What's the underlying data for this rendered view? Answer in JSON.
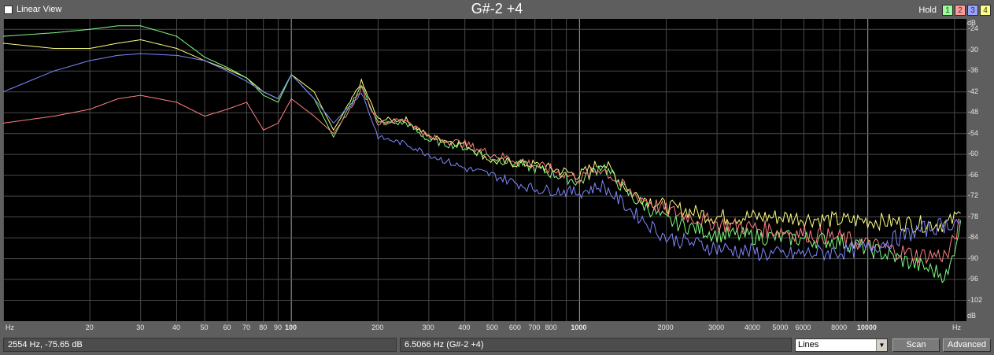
{
  "header": {
    "linear_view_label": "Linear View",
    "title": "G#-2 +4",
    "hold_label": "Hold",
    "hold_buttons": [
      {
        "label": "1",
        "color": "#9aff9a"
      },
      {
        "label": "2",
        "color": "#ff9a9a"
      },
      {
        "label": "3",
        "color": "#9aa2ff"
      },
      {
        "label": "4",
        "color": "#ffff88"
      }
    ]
  },
  "status": {
    "cursor_readout": "2554 Hz, -75.65 dB",
    "pitch_readout": "6.5066 Hz (G#-2 +4)",
    "mode_select": "Lines",
    "scan_label": "Scan",
    "advanced_label": "Advanced"
  },
  "chart_data": {
    "type": "line",
    "x_scale": "log",
    "xlim": [
      10,
      22000
    ],
    "ylim": [
      -108,
      -21
    ],
    "x_unit_label": "Hz",
    "y_unit_label": "dB",
    "y_ticks": [
      -24,
      -30,
      -36,
      -42,
      -48,
      -54,
      -60,
      -66,
      -72,
      -78,
      -84,
      -90,
      -96,
      -102
    ],
    "x_ticks": [
      {
        "v": 20,
        "label": "20"
      },
      {
        "v": 30,
        "label": "30"
      },
      {
        "v": 40,
        "label": "40"
      },
      {
        "v": 50,
        "label": "50"
      },
      {
        "v": 60,
        "label": "60"
      },
      {
        "v": 70,
        "label": "70"
      },
      {
        "v": 80,
        "label": "80"
      },
      {
        "v": 90,
        "label": "90"
      },
      {
        "v": 100,
        "label": "100"
      },
      {
        "v": 200,
        "label": "200"
      },
      {
        "v": 300,
        "label": "300"
      },
      {
        "v": 400,
        "label": "400"
      },
      {
        "v": 500,
        "label": "500"
      },
      {
        "v": 600,
        "label": "600"
      },
      {
        "v": 700,
        "label": "700"
      },
      {
        "v": 800,
        "label": "800"
      },
      {
        "v": 1000,
        "label": "1000"
      },
      {
        "v": 2000,
        "label": "2000"
      },
      {
        "v": 3000,
        "label": "3000"
      },
      {
        "v": 4000,
        "label": "4000"
      },
      {
        "v": 5000,
        "label": "5000"
      },
      {
        "v": 6000,
        "label": "6000"
      },
      {
        "v": 8000,
        "label": "8000"
      },
      {
        "v": 10000,
        "label": "10000"
      }
    ],
    "grid": true,
    "series": [
      {
        "color": "#ffff80",
        "points": [
          [
            10,
            -28
          ],
          [
            15,
            -29.5
          ],
          [
            20,
            -29.5
          ],
          [
            25,
            -28
          ],
          [
            30,
            -27
          ],
          [
            40,
            -29.5
          ],
          [
            50,
            -33
          ],
          [
            60,
            -35.5
          ],
          [
            70,
            -38
          ],
          [
            80,
            -42
          ],
          [
            90,
            -44
          ],
          [
            100,
            -37
          ],
          [
            120,
            -42
          ],
          [
            140,
            -53
          ],
          [
            160,
            -45
          ],
          [
            175,
            -39
          ],
          [
            200,
            -50
          ],
          [
            250,
            -50
          ],
          [
            300,
            -55
          ],
          [
            400,
            -57
          ],
          [
            500,
            -62
          ],
          [
            700,
            -63
          ],
          [
            1000,
            -66
          ],
          [
            1200,
            -62
          ],
          [
            1500,
            -71
          ],
          [
            2000,
            -75
          ],
          [
            3000,
            -78
          ],
          [
            5000,
            -78
          ],
          [
            8000,
            -79
          ],
          [
            10000,
            -79
          ],
          [
            15000,
            -80
          ],
          [
            19000,
            -80
          ],
          [
            21000,
            -77
          ]
        ]
      },
      {
        "color": "#80ff80",
        "points": [
          [
            10,
            -26
          ],
          [
            15,
            -25
          ],
          [
            20,
            -24
          ],
          [
            25,
            -23
          ],
          [
            30,
            -23
          ],
          [
            40,
            -26
          ],
          [
            50,
            -32
          ],
          [
            60,
            -35
          ],
          [
            70,
            -38
          ],
          [
            80,
            -43
          ],
          [
            90,
            -45
          ],
          [
            100,
            -37
          ],
          [
            120,
            -44
          ],
          [
            140,
            -55
          ],
          [
            160,
            -46
          ],
          [
            175,
            -40
          ],
          [
            200,
            -51
          ],
          [
            250,
            -51
          ],
          [
            300,
            -56
          ],
          [
            400,
            -58
          ],
          [
            500,
            -61
          ],
          [
            700,
            -64
          ],
          [
            1000,
            -68
          ],
          [
            1200,
            -63
          ],
          [
            1500,
            -72
          ],
          [
            2000,
            -79
          ],
          [
            3000,
            -83
          ],
          [
            5000,
            -84
          ],
          [
            8000,
            -85
          ],
          [
            10000,
            -87
          ],
          [
            15000,
            -92
          ],
          [
            19000,
            -95
          ],
          [
            21000,
            -79
          ]
        ]
      },
      {
        "color": "#ff8080",
        "points": [
          [
            10,
            -51
          ],
          [
            15,
            -49
          ],
          [
            20,
            -47
          ],
          [
            25,
            -44
          ],
          [
            30,
            -43
          ],
          [
            40,
            -45
          ],
          [
            50,
            -49
          ],
          [
            60,
            -47
          ],
          [
            70,
            -45
          ],
          [
            80,
            -53
          ],
          [
            90,
            -51
          ],
          [
            100,
            -44
          ],
          [
            120,
            -49
          ],
          [
            140,
            -54
          ],
          [
            160,
            -47
          ],
          [
            175,
            -41
          ],
          [
            200,
            -51
          ],
          [
            250,
            -50
          ],
          [
            300,
            -55
          ],
          [
            400,
            -57
          ],
          [
            500,
            -60
          ],
          [
            700,
            -63
          ],
          [
            1000,
            -67
          ],
          [
            1200,
            -64
          ],
          [
            1500,
            -71
          ],
          [
            2000,
            -76
          ],
          [
            3000,
            -80
          ],
          [
            5000,
            -82
          ],
          [
            8000,
            -84
          ],
          [
            10000,
            -86
          ],
          [
            15000,
            -89
          ],
          [
            19000,
            -89
          ],
          [
            21000,
            -79
          ]
        ]
      },
      {
        "color": "#8088ff",
        "points": [
          [
            10,
            -42
          ],
          [
            15,
            -36
          ],
          [
            20,
            -33
          ],
          [
            25,
            -31.5
          ],
          [
            30,
            -31
          ],
          [
            40,
            -31.5
          ],
          [
            50,
            -33
          ],
          [
            60,
            -36
          ],
          [
            70,
            -39
          ],
          [
            80,
            -42
          ],
          [
            90,
            -44
          ],
          [
            100,
            -37
          ],
          [
            120,
            -44
          ],
          [
            140,
            -51
          ],
          [
            160,
            -46
          ],
          [
            175,
            -42
          ],
          [
            200,
            -55
          ],
          [
            250,
            -57
          ],
          [
            300,
            -60
          ],
          [
            400,
            -64
          ],
          [
            500,
            -66
          ],
          [
            700,
            -70
          ],
          [
            1000,
            -71
          ],
          [
            1200,
            -69
          ],
          [
            1500,
            -76
          ],
          [
            2000,
            -84
          ],
          [
            3000,
            -87
          ],
          [
            5000,
            -89
          ],
          [
            8000,
            -88
          ],
          [
            10000,
            -87
          ],
          [
            15000,
            -82
          ],
          [
            19000,
            -80
          ],
          [
            21000,
            -79
          ]
        ]
      }
    ]
  }
}
